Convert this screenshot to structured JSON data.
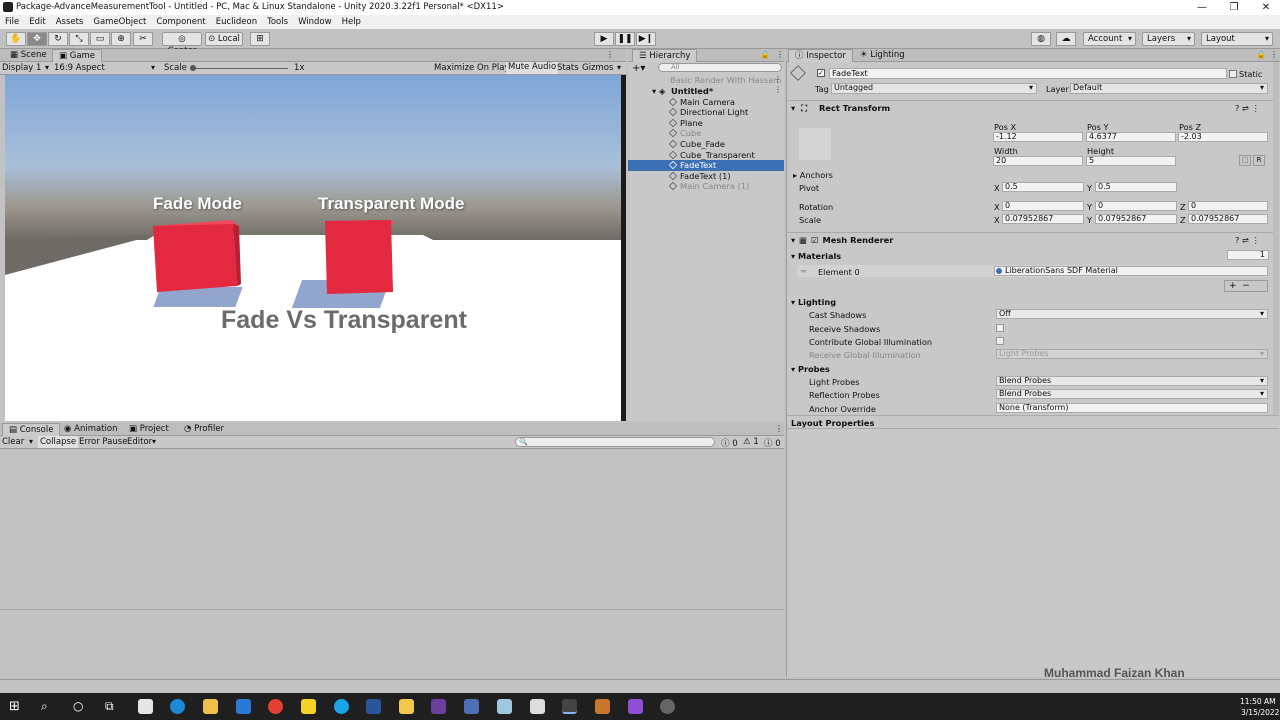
{
  "window": {
    "title": "Package-AdvanceMeasurementTool - Untitled - PC, Mac & Linux Standalone - Unity 2020.3.22f1 Personal* <DX11>"
  },
  "menu": [
    "File",
    "Edit",
    "Assets",
    "GameObject",
    "Component",
    "Euclideon",
    "Tools",
    "Window",
    "Help"
  ],
  "toolbar": {
    "center": "Center",
    "local": "Local",
    "account": "Account",
    "layers": "Layers",
    "layout": "Layout"
  },
  "gamepanel": {
    "tab_scene": "Scene",
    "tab_game": "Game",
    "display": "Display 1",
    "aspect": "16:9 Aspect",
    "scale_label": "Scale",
    "scale_value": "1x",
    "maximize": "Maximize On Play",
    "mute": "Mute Audio",
    "stats": "Stats",
    "gizmos": "Gizmos"
  },
  "scene": {
    "label_fade": "Fade Mode",
    "label_transparent": "Transparent Mode",
    "label_title": "Fade Vs Transparent"
  },
  "hierarchy": {
    "title": "Hierarchy",
    "search_placeholder": "All",
    "scene_header": "Basic Render With Hassam",
    "root": "Untitled*",
    "items": [
      "Main Camera",
      "Directional Light",
      "Plane",
      "Cube",
      "Cube_Fade",
      "Cube_Transparent",
      "FadeText",
      "FadeText (1)",
      "Main Camera (1)"
    ]
  },
  "inspector": {
    "tab_inspector": "Inspector",
    "tab_lighting": "Lighting",
    "object_name": "FadeText",
    "static": "Static",
    "tag_label": "Tag",
    "tag": "Untagged",
    "layer_label": "Layer",
    "layer": "Default",
    "rect_transform": "Rect Transform",
    "posx_l": "Pos X",
    "posy_l": "Pos Y",
    "posz_l": "Pos Z",
    "posx": "-1.12",
    "posy": "4.6377",
    "posz": "-2.03",
    "width_l": "Width",
    "height_l": "Height",
    "width": "20",
    "height": "5",
    "anchors": "Anchors",
    "pivot": "Pivot",
    "pivot_x": "0.5",
    "pivot_y": "0.5",
    "rotation": "Rotation",
    "rot_x": "0",
    "rot_y": "0",
    "rot_z": "0",
    "scale": "Scale",
    "scale_x": "0.07952867",
    "scale_y": "0.07952867",
    "scale_z": "0.07952867",
    "mesh_renderer": "Mesh Renderer",
    "materials": "Materials",
    "materials_count": "1",
    "element0": "Element 0",
    "element0_value": "LiberationSans SDF Material",
    "lighting": "Lighting",
    "cast_shadows": "Cast Shadows",
    "cast_shadows_v": "Off",
    "receive_shadows": "Receive Shadows",
    "contribute_gi": "Contribute Global Illumination",
    "receive_gi": "Receive Global Illumination",
    "receive_gi_v": "Light Probes",
    "probes": "Probes",
    "light_probes": "Light Probes",
    "light_probes_v": "Blend Probes",
    "reflection_probes": "Reflection Probes",
    "reflection_probes_v": "Blend Probes",
    "anchor_override": "Anchor Override",
    "anchor_override_v": "None (Transform)",
    "layout_properties": "Layout Properties",
    "r": "R",
    "x": "X",
    "y": "Y",
    "z": "Z"
  },
  "console": {
    "tab_console": "Console",
    "tab_animation": "Animation",
    "tab_project": "Project",
    "tab_profiler": "Profiler",
    "clear": "Clear",
    "collapse": "Collapse",
    "error_pause": "Error Pause",
    "editor": "Editor",
    "count_info": "0",
    "count_warn": "1",
    "count_err": "0"
  },
  "watermark": "Muhammad Faizan Khan",
  "clock": {
    "time": "11:50 AM",
    "date": "3/15/2022"
  }
}
